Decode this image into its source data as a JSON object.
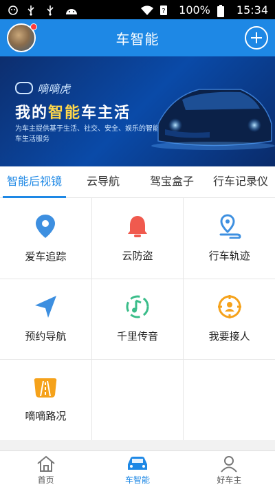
{
  "status_bar": {
    "battery": "100%",
    "time": "15:34",
    "icons": [
      "sim-icon",
      "usb-icon",
      "usb-icon",
      "android-icon",
      "wifi-icon",
      "sim-unknown-icon",
      "battery-icon"
    ]
  },
  "header": {
    "title": "车智能"
  },
  "banner": {
    "brand": "嘀嘀虎",
    "headline_prefix": "我的",
    "headline_highlight": "智能",
    "headline_suffix": "车主活",
    "subtitle": "为车主提供基于生活、社交、安全、娱乐的智能车生活服务"
  },
  "tabs": [
    {
      "label": "智能后视镜",
      "active": true
    },
    {
      "label": "云导航",
      "active": false
    },
    {
      "label": "驾宝盒子",
      "active": false
    },
    {
      "label": "行车记录仪",
      "active": false
    }
  ],
  "features": [
    {
      "label": "爱车追踪",
      "icon": "location-pin-icon"
    },
    {
      "label": "云防盗",
      "icon": "alarm-bell-icon"
    },
    {
      "label": "行车轨迹",
      "icon": "route-pin-icon"
    },
    {
      "label": "预约导航",
      "icon": "navigation-arrow-icon"
    },
    {
      "label": "千里传音",
      "icon": "music-note-icon"
    },
    {
      "label": "我要接人",
      "icon": "pickup-person-icon"
    },
    {
      "label": "嘀嘀路况",
      "icon": "road-icon"
    }
  ],
  "bottom_nav": [
    {
      "label": "首页",
      "active": false
    },
    {
      "label": "车智能",
      "active": true
    },
    {
      "label": "好车主",
      "active": false
    }
  ],
  "colors": {
    "primary": "#1e88e5",
    "blue_icon": "#3d8fe0",
    "red_icon": "#f05a4e",
    "green_icon": "#3bbd8a",
    "orange_icon": "#f5a21b"
  }
}
